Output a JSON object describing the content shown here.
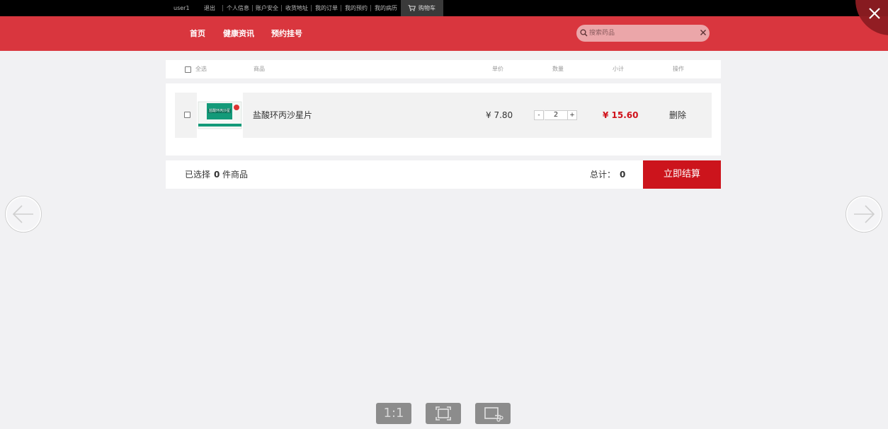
{
  "topbar": {
    "username": "user1",
    "logout": "退出",
    "links": [
      "个人信息",
      "账户安全",
      "收货地址",
      "我的订单",
      "我的预约",
      "我的病历"
    ],
    "cart": "购物车"
  },
  "header": {
    "nav": [
      "首页",
      "健康资讯",
      "预约挂号"
    ],
    "search_placeholder": "搜索药品"
  },
  "cart_head": {
    "select_all": "全选",
    "product": "商品",
    "unit_price": "单价",
    "quantity": "数量",
    "subtotal": "小计",
    "action": "操作"
  },
  "items": [
    {
      "name": "盐酸环丙沙星片",
      "thumb_text": "盐酸环丙沙星片",
      "unit_price": "¥ 7.80",
      "quantity": "2",
      "subtotal": "¥ 15.60",
      "delete": "删除"
    }
  ],
  "qty_controls": {
    "minus": "-",
    "plus": "+"
  },
  "footer": {
    "selected_prefix": "已选择",
    "selected_count": "0",
    "selected_suffix": "件商品",
    "total_label": "总计：",
    "total_value": "0",
    "checkout": "立即结算"
  },
  "viewer": {
    "actual_size": "1:1"
  },
  "colors": {
    "brand_red": "#d9363e",
    "checkout_red": "#cc141c",
    "price_red": "#d0121b"
  }
}
